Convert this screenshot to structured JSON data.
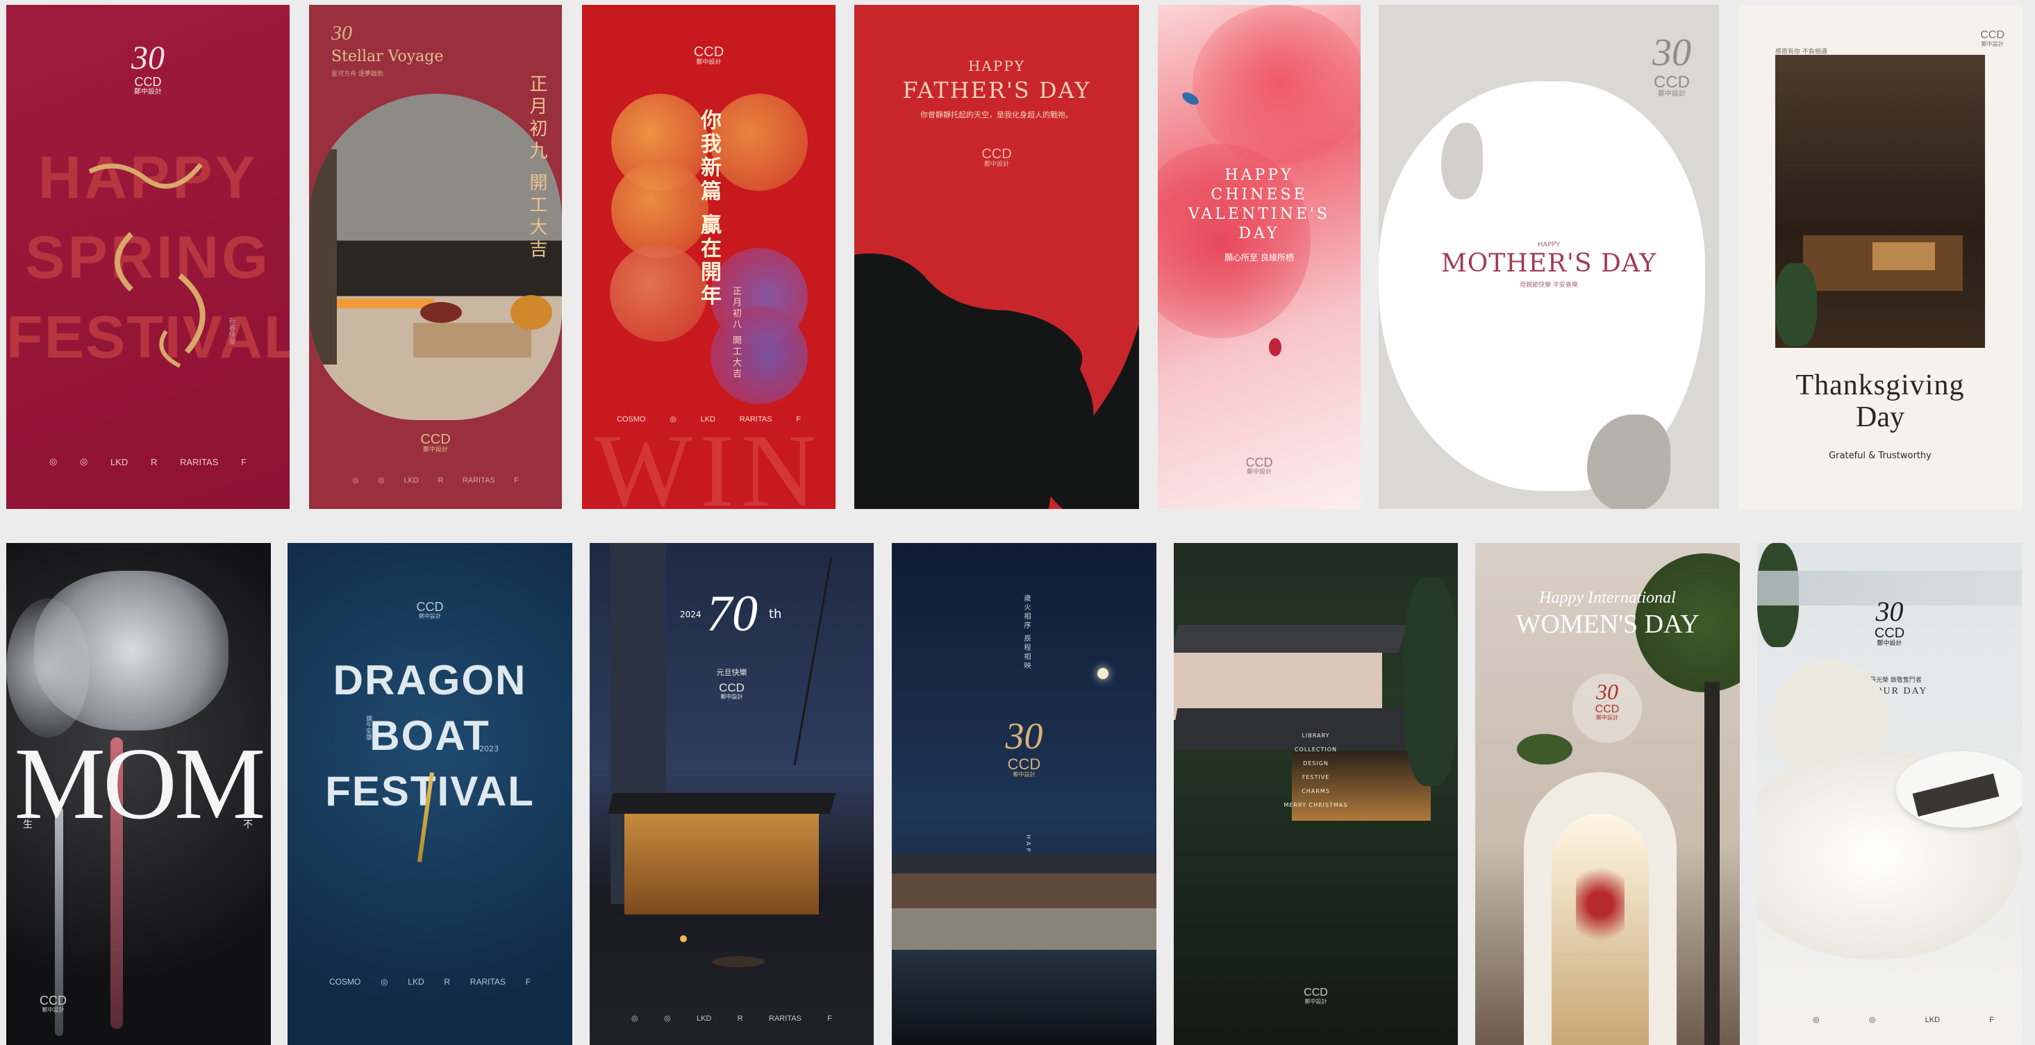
{
  "top_row": {
    "p1": {
      "logo_num": "30",
      "logo": "CCD",
      "logo_sub": "鄭中設計",
      "line1": "HAPPY",
      "line2": "SPRING",
      "line3": "FESTIVAL",
      "side": "新春快樂"
    },
    "p2": {
      "logo_num": "30",
      "brand": "Stellar Voyage",
      "brand_sub": "星河方舟 逐夢啟航",
      "vertical": "正月初九 開工大吉",
      "logo": "CCD",
      "logo_sub": "鄭中設計"
    },
    "p3": {
      "logo": "CCD",
      "logo_sub": "鄭中設計",
      "vertical_main": "你我新篇 贏在開年",
      "vertical_sub": "正月初八 開工大吉",
      "big_word": "WIN"
    },
    "p4": {
      "line1": "HAPPY",
      "line2": "FATHER'S DAY",
      "sub": "你曾靜靜托起的天空，是我化身超人的戰袍。",
      "logo": "CCD",
      "logo_sub": "鄭中設計"
    },
    "p5": {
      "line1": "HAPPY",
      "line2": "CHINESE",
      "line3": "VALENTINE'S",
      "line4": "DAY",
      "sub": "願心所至 良緣所栖",
      "logo": "CCD",
      "logo_sub": "鄭中設計"
    },
    "p6": {
      "logo_num": "30",
      "logo": "CCD",
      "logo_sub": "鄭中設計",
      "small": "HAPPY",
      "title": "MOTHER'S DAY",
      "sub": "母親節快樂 平安喜樂"
    },
    "p7": {
      "top_left": "感恩有你 不負相遇",
      "logo": "CCD",
      "logo_sub": "鄭中設計",
      "title1": "Thanksgiving",
      "title2": "Day",
      "sub": "Grateful & Trustworthy"
    }
  },
  "bottom_row": {
    "p8": {
      "title": "MOM",
      "sub_left": "生",
      "sub_right": "不",
      "logo": "CCD",
      "logo_sub": "鄭中設計"
    },
    "p9": {
      "logo": "CCD",
      "logo_sub": "鄭中設計",
      "line1": "DRAGON",
      "line2": "BOAT",
      "line3": "FESTIVAL",
      "side": "端午安康",
      "year": "2023"
    },
    "p10": {
      "year": "2024",
      "num": "70",
      "suffix": "th",
      "sub": "元旦快樂",
      "logo": "CCD",
      "logo_sub": "鄭中設計"
    },
    "p11": {
      "vertical": "歲火相序 辰程相映",
      "logo_num": "30",
      "logo": "CCD",
      "logo_sub": "鄭中設計",
      "vertical2": "HAPPY NEW YEAR"
    },
    "p12": {
      "tree1": "LIBRARY",
      "tree2": "COLLECTION",
      "tree3": "DESIGN",
      "tree4": "FESTIVE",
      "tree5": "CHARMS",
      "tree6": "MERRY CHRISTMAS",
      "logo": "CCD",
      "logo_sub": "鄭中設計"
    },
    "p13": {
      "script": "Happy International",
      "title": "WOMEN'S DAY",
      "logo_num": "30",
      "logo": "CCD",
      "logo_sub": "鄭中設計"
    },
    "p14": {
      "logo_num": "30",
      "logo": "CCD",
      "logo_sub": "鄭中設計",
      "sub": "勞動最光榮 致敬奮鬥者",
      "title": "LABOUR DAY"
    }
  },
  "partners": {
    "a": "COSMO",
    "b": "◎",
    "c": "◎",
    "d": "LKD",
    "e": "R",
    "f": "RARITAS",
    "g": "F"
  },
  "colors": {
    "background": "#ececec",
    "crimson": "#9e1438",
    "red": "#c8191e",
    "gold": "#d8b27a",
    "navy": "#163a5a"
  }
}
